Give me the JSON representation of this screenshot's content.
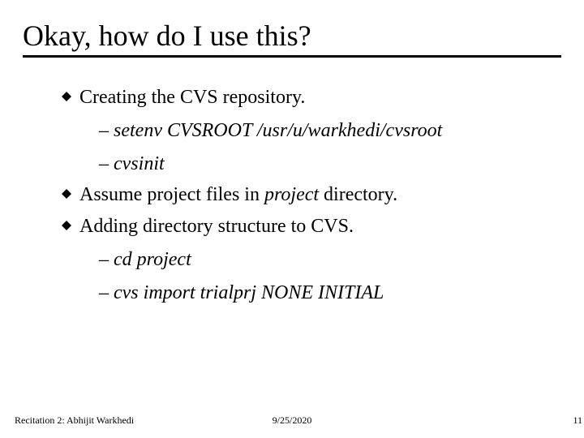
{
  "title": "Okay, how do I use this?",
  "bullets": {
    "b1": "Creating the CVS repository.",
    "b1_sub1": "setenv CVSROOT /usr/u/warkhedi/cvsroot",
    "b1_sub2": "cvsinit",
    "b2_pre": "Assume project files in ",
    "b2_italic": "project",
    "b2_post": " directory.",
    "b3": "Adding directory structure to CVS.",
    "b3_sub1": "cd project",
    "b3_sub2": "cvs import trialprj NONE INITIAL"
  },
  "footer": {
    "left": "Recitation 2: Abhijit Warkhedi",
    "center": "9/25/2020",
    "right": "11"
  }
}
